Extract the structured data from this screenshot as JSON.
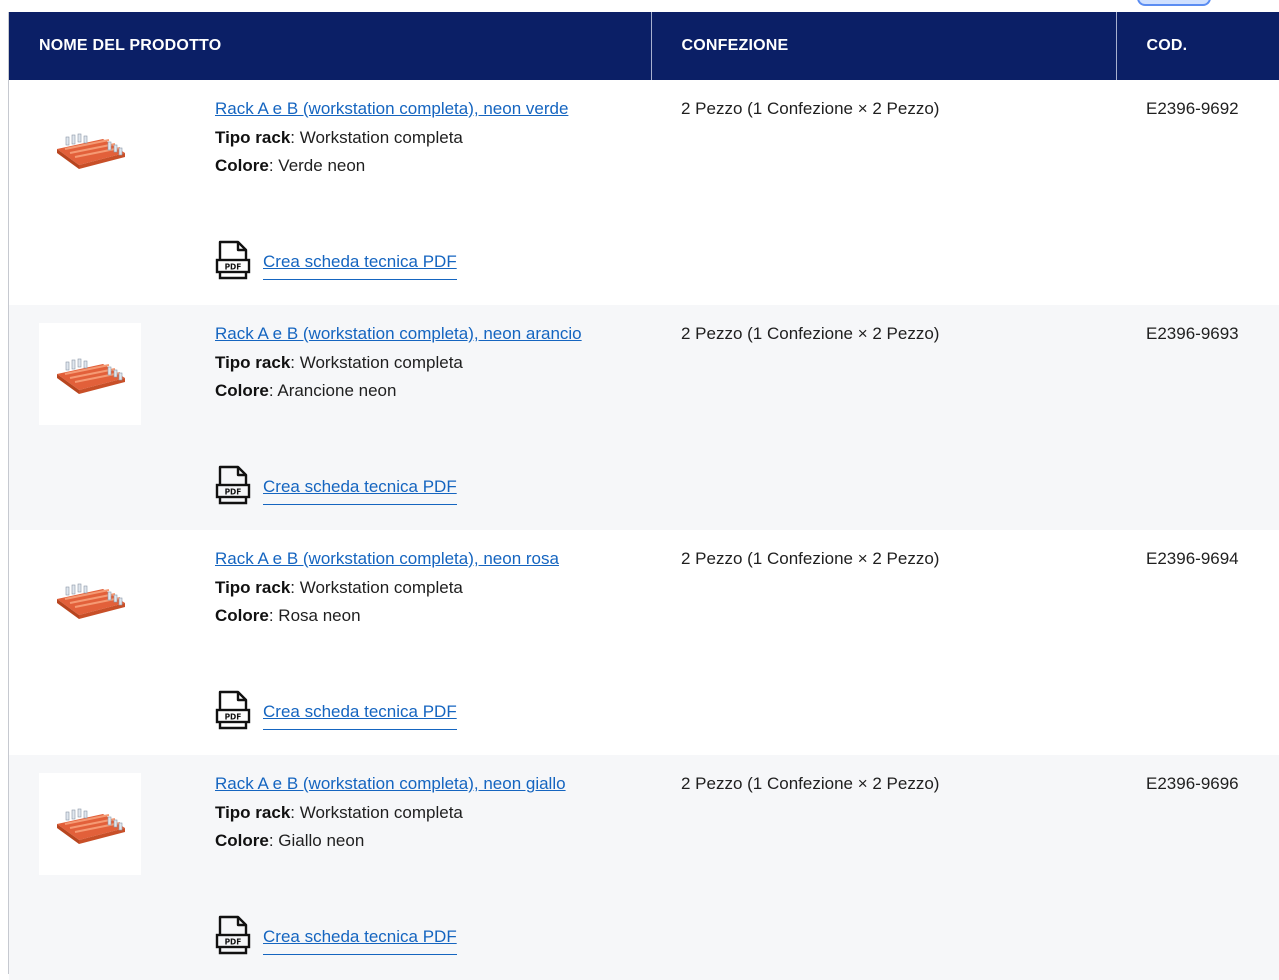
{
  "header": {
    "col_name": "NOME DEL PRODOTTO",
    "col_pack": "CONFEZIONE",
    "col_code": "COD."
  },
  "colors": {
    "header_bg": "#0b1f66",
    "link": "#1565c0",
    "rack": "#e2603a"
  },
  "rows": [
    {
      "title": "Rack A e B (workstation completa), neon verde",
      "rack_type_label": "Tipo rack",
      "rack_type_value": ": Workstation completa",
      "color_label": "Colore",
      "color_value": ": Verde neon",
      "pdf_label": "Crea scheda tecnica PDF",
      "packaging": "2 Pezzo (1 Confezione × 2 Pezzo)",
      "code": "E2396-9692"
    },
    {
      "title": "Rack A e B (workstation completa), neon arancio",
      "rack_type_label": "Tipo rack",
      "rack_type_value": ": Workstation completa",
      "color_label": "Colore",
      "color_value": ": Arancione neon",
      "pdf_label": "Crea scheda tecnica PDF",
      "packaging": "2 Pezzo (1 Confezione × 2 Pezzo)",
      "code": "E2396-9693"
    },
    {
      "title": "Rack A e B (workstation completa), neon rosa",
      "rack_type_label": "Tipo rack",
      "rack_type_value": ": Workstation completa",
      "color_label": "Colore",
      "color_value": ": Rosa neon",
      "pdf_label": "Crea scheda tecnica PDF",
      "packaging": "2 Pezzo (1 Confezione × 2 Pezzo)",
      "code": "E2396-9694"
    },
    {
      "title": "Rack A e B (workstation completa), neon giallo",
      "rack_type_label": "Tipo rack",
      "rack_type_value": ": Workstation completa",
      "color_label": "Colore",
      "color_value": ": Giallo neon",
      "pdf_label": "Crea scheda tecnica PDF",
      "packaging": "2 Pezzo (1 Confezione × 2 Pezzo)",
      "code": "E2396-9696"
    }
  ],
  "icons": {
    "product_image": "tube-rack-image",
    "pdf": "pdf-file-icon"
  }
}
